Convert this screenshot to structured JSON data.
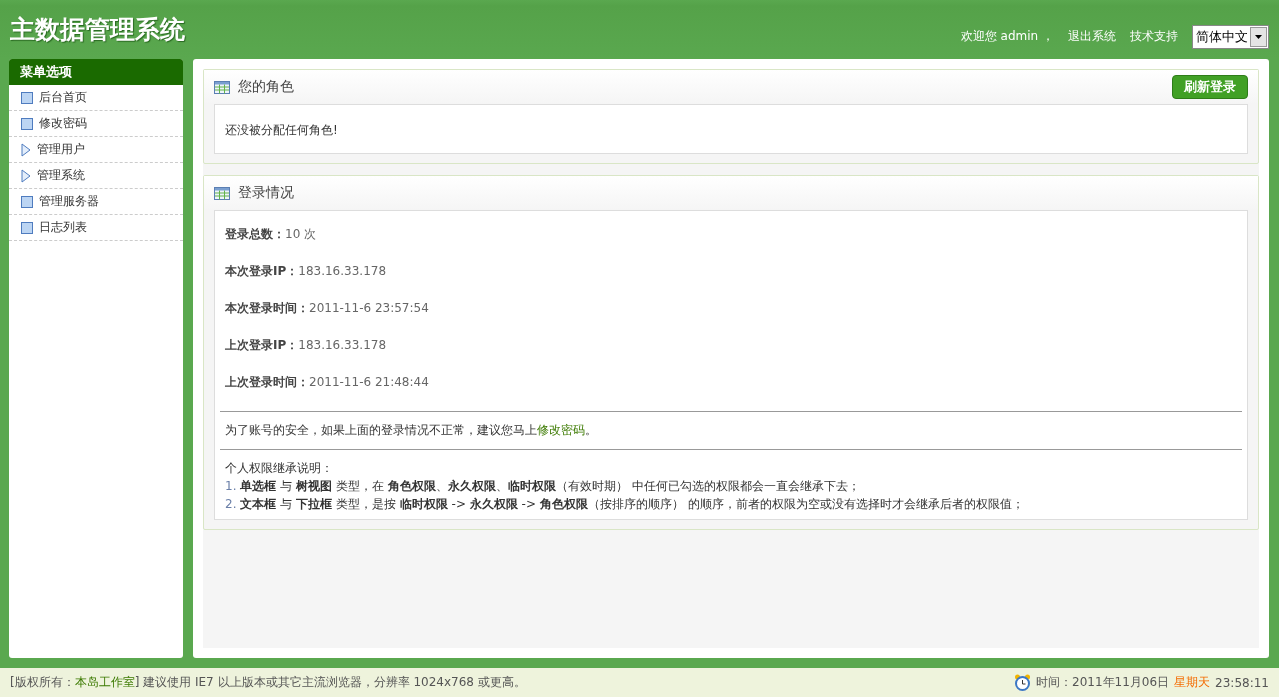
{
  "header": {
    "title": "主数据管理系统",
    "welcome": "欢迎您 admin ，",
    "links": [
      "退出系统",
      "技术支持"
    ],
    "language": "简体中文"
  },
  "sidebar": {
    "title": "菜单选项",
    "items": [
      {
        "label": "后台首页",
        "kind": "page"
      },
      {
        "label": "修改密码",
        "kind": "page"
      },
      {
        "label": "管理用户",
        "kind": "group"
      },
      {
        "label": "管理系统",
        "kind": "group"
      },
      {
        "label": "管理服务器",
        "kind": "page"
      },
      {
        "label": "日志列表",
        "kind": "page"
      }
    ]
  },
  "role_panel": {
    "title": "您的角色",
    "button": "刷新登录",
    "message": "还没被分配任何角色!"
  },
  "login_panel": {
    "title": "登录情况",
    "rows": [
      {
        "label": "登录总数：",
        "value": "10 次"
      },
      {
        "label": "本次登录IP：",
        "value": "183.16.33.178"
      },
      {
        "label": "本次登录时间：",
        "value": "2011-11-6 23:57:54"
      },
      {
        "label": "上次登录IP：",
        "value": "183.16.33.178"
      },
      {
        "label": "上次登录时间：",
        "value": "2011-11-6 21:48:44"
      }
    ],
    "notice": {
      "before": "为了账号的安全，如果上面的登录情况不正常，建议您马上",
      "link": "修改密码",
      "after": "。"
    },
    "rules_title": "个人权限继承说明：",
    "rules": [
      {
        "number": "1.",
        "text": "**单选框** 与 **树视图** 类型，在 **角色权限**、**永久权限**、**临时权限**（有效时期） 中任何已勾选的权限都会一直会继承下去；"
      },
      {
        "number": "2.",
        "text": "**文本框** 与 **下拉框** 类型，是按 **临时权限** -> **永久权限** -> **角色权限**（按排序的顺序） 的顺序，前者的权限为空或没有选择时才会继承后者的权限值；"
      }
    ]
  },
  "footer": {
    "before": "[版权所有：",
    "link": "本岛工作室",
    "after": "] 建议使用 IE7 以上版本或其它主流浏览器，分辨率 1024x768 或更高。",
    "time_label": "时间：2011年11月06日",
    "weekday": "星期天",
    "time": "23:58:11"
  }
}
